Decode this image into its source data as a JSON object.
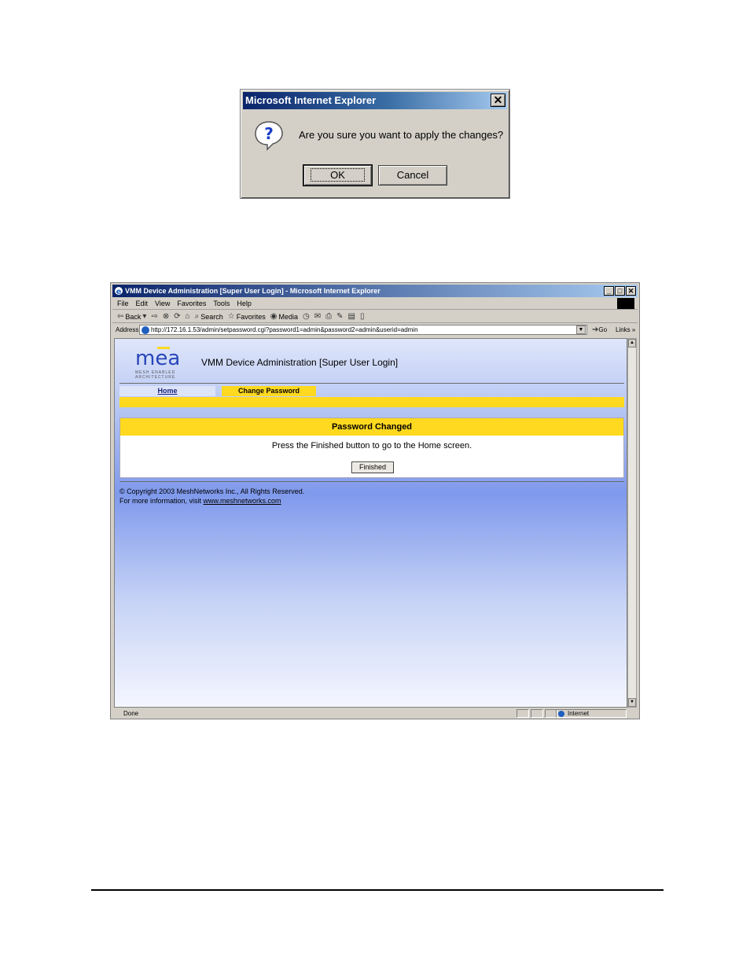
{
  "dialog": {
    "title": "Microsoft Internet Explorer",
    "close": "✕",
    "message": "Are you sure you want to apply the changes?",
    "ok_label": "OK",
    "cancel_label": "Cancel"
  },
  "browser": {
    "window_title": "VMM Device Administration [Super User Login] - Microsoft Internet Explorer",
    "controls": {
      "minimize": "_",
      "maximize": "□",
      "close": "✕"
    },
    "menu": [
      "File",
      "Edit",
      "View",
      "Favorites",
      "Tools",
      "Help"
    ],
    "toolbar": {
      "back": "Back",
      "search": "Search",
      "favorites": "Favorites",
      "media": "Media"
    },
    "address_label": "Address",
    "url": "http://172.16.1.53/admin/setpassword.cgi?password1=admin&password2=admin&userid=admin",
    "go_label": "Go",
    "links_label": "Links",
    "status_text": "Done",
    "zone_text": "Internet"
  },
  "page": {
    "logo_text": "mea",
    "logo_subtext_1": "MESH ENABLED",
    "logo_subtext_2": "ARCHITECTURE",
    "title": "VMM Device Administration [Super User Login]",
    "tabs": [
      {
        "label": "Home"
      },
      {
        "label": "Change Password"
      }
    ],
    "panel_heading": "Password Changed",
    "panel_message": "Press the Finished button to go to the Home screen.",
    "finished_label": "Finished",
    "copyright": "© Copyright 2003 MeshNetworks Inc., All Rights Reserved.",
    "more_info_prefix": "For more information, visit ",
    "more_info_link": "www.meshnetworks.com"
  },
  "colors": {
    "accent_yellow": "#ffd91f",
    "title_bar": "#0a246a",
    "page_blue": "#7f99ec"
  }
}
